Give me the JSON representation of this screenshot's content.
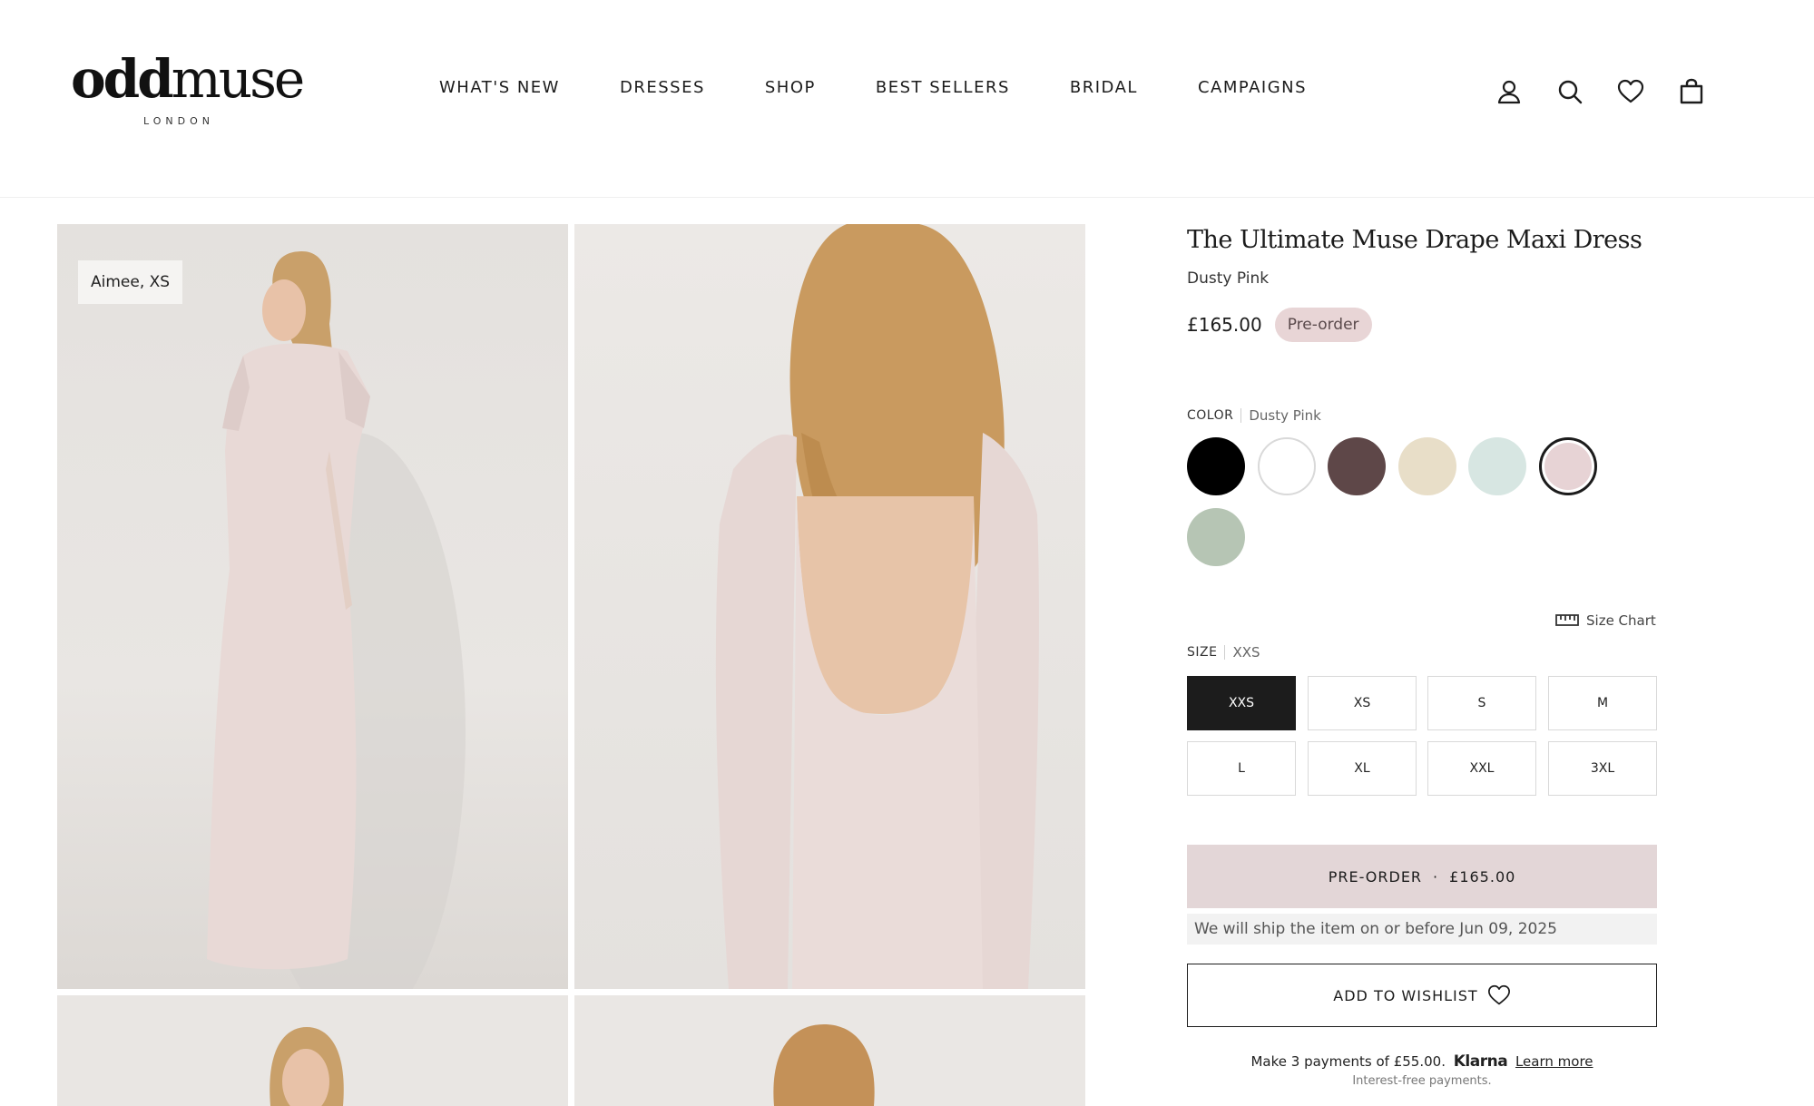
{
  "brand": {
    "name_bold": "odd",
    "name_light": "muse",
    "sub": "LONDON"
  },
  "nav": {
    "items": [
      {
        "label": "WHAT'S NEW"
      },
      {
        "label": "DRESSES"
      },
      {
        "label": "SHOP"
      },
      {
        "label": "BEST SELLERS"
      },
      {
        "label": "BRIDAL"
      },
      {
        "label": "CAMPAIGNS"
      }
    ]
  },
  "header_icons": [
    "account-icon",
    "search-icon",
    "heart-icon",
    "bag-icon"
  ],
  "gallery": {
    "model_tag": "Aimee, XS"
  },
  "product": {
    "title": "The Ultimate Muse Drape Maxi Dress",
    "color_name": "Dusty Pink",
    "price": "£165.00",
    "badge": "Pre-order"
  },
  "color": {
    "label": "COLOR",
    "selected": "Dusty Pink",
    "swatches": [
      {
        "hex": "#000000"
      },
      {
        "hex": "#ffffff"
      },
      {
        "hex": "#5e4748"
      },
      {
        "hex": "#e8dec8"
      },
      {
        "hex": "#d7e6e2"
      },
      {
        "hex": "#e7d3d5"
      },
      {
        "hex": "#b6c5b4"
      }
    ]
  },
  "size": {
    "chart_label": "Size Chart",
    "label": "SIZE",
    "selected": "XXS",
    "options": [
      "XXS",
      "XS",
      "S",
      "M",
      "L",
      "XL",
      "XXL",
      "3XL"
    ]
  },
  "cta": {
    "preorder_label": "PRE-ORDER",
    "dot": "·",
    "preorder_price": "£165.00",
    "ship_note": "We will ship the item on or before Jun 09, 2025",
    "wishlist_label": "ADD TO WISHLIST"
  },
  "klarna": {
    "text": "Make 3 payments of £55.00.",
    "brand": "Klarna",
    "learn_more": "Learn more",
    "sub": "Interest-free payments."
  },
  "colors": {
    "accent_preorder": "#e3d6d7",
    "badge_bg": "#e8d5d6",
    "dark": "#1c1c1c"
  }
}
